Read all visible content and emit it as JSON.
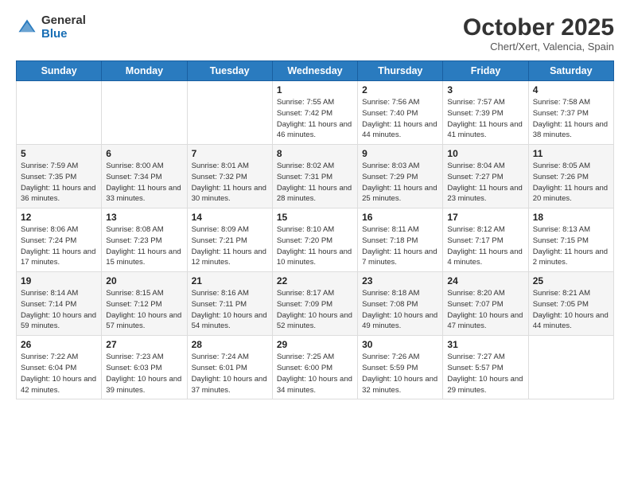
{
  "logo": {
    "general": "General",
    "blue": "Blue"
  },
  "title": "October 2025",
  "subtitle": "Chert/Xert, Valencia, Spain",
  "weekdays": [
    "Sunday",
    "Monday",
    "Tuesday",
    "Wednesday",
    "Thursday",
    "Friday",
    "Saturday"
  ],
  "weeks": [
    [
      {
        "day": "",
        "sunrise": "",
        "sunset": "",
        "daylight": ""
      },
      {
        "day": "",
        "sunrise": "",
        "sunset": "",
        "daylight": ""
      },
      {
        "day": "",
        "sunrise": "",
        "sunset": "",
        "daylight": ""
      },
      {
        "day": "1",
        "sunrise": "Sunrise: 7:55 AM",
        "sunset": "Sunset: 7:42 PM",
        "daylight": "Daylight: 11 hours and 46 minutes."
      },
      {
        "day": "2",
        "sunrise": "Sunrise: 7:56 AM",
        "sunset": "Sunset: 7:40 PM",
        "daylight": "Daylight: 11 hours and 44 minutes."
      },
      {
        "day": "3",
        "sunrise": "Sunrise: 7:57 AM",
        "sunset": "Sunset: 7:39 PM",
        "daylight": "Daylight: 11 hours and 41 minutes."
      },
      {
        "day": "4",
        "sunrise": "Sunrise: 7:58 AM",
        "sunset": "Sunset: 7:37 PM",
        "daylight": "Daylight: 11 hours and 38 minutes."
      }
    ],
    [
      {
        "day": "5",
        "sunrise": "Sunrise: 7:59 AM",
        "sunset": "Sunset: 7:35 PM",
        "daylight": "Daylight: 11 hours and 36 minutes."
      },
      {
        "day": "6",
        "sunrise": "Sunrise: 8:00 AM",
        "sunset": "Sunset: 7:34 PM",
        "daylight": "Daylight: 11 hours and 33 minutes."
      },
      {
        "day": "7",
        "sunrise": "Sunrise: 8:01 AM",
        "sunset": "Sunset: 7:32 PM",
        "daylight": "Daylight: 11 hours and 30 minutes."
      },
      {
        "day": "8",
        "sunrise": "Sunrise: 8:02 AM",
        "sunset": "Sunset: 7:31 PM",
        "daylight": "Daylight: 11 hours and 28 minutes."
      },
      {
        "day": "9",
        "sunrise": "Sunrise: 8:03 AM",
        "sunset": "Sunset: 7:29 PM",
        "daylight": "Daylight: 11 hours and 25 minutes."
      },
      {
        "day": "10",
        "sunrise": "Sunrise: 8:04 AM",
        "sunset": "Sunset: 7:27 PM",
        "daylight": "Daylight: 11 hours and 23 minutes."
      },
      {
        "day": "11",
        "sunrise": "Sunrise: 8:05 AM",
        "sunset": "Sunset: 7:26 PM",
        "daylight": "Daylight: 11 hours and 20 minutes."
      }
    ],
    [
      {
        "day": "12",
        "sunrise": "Sunrise: 8:06 AM",
        "sunset": "Sunset: 7:24 PM",
        "daylight": "Daylight: 11 hours and 17 minutes."
      },
      {
        "day": "13",
        "sunrise": "Sunrise: 8:08 AM",
        "sunset": "Sunset: 7:23 PM",
        "daylight": "Daylight: 11 hours and 15 minutes."
      },
      {
        "day": "14",
        "sunrise": "Sunrise: 8:09 AM",
        "sunset": "Sunset: 7:21 PM",
        "daylight": "Daylight: 11 hours and 12 minutes."
      },
      {
        "day": "15",
        "sunrise": "Sunrise: 8:10 AM",
        "sunset": "Sunset: 7:20 PM",
        "daylight": "Daylight: 11 hours and 10 minutes."
      },
      {
        "day": "16",
        "sunrise": "Sunrise: 8:11 AM",
        "sunset": "Sunset: 7:18 PM",
        "daylight": "Daylight: 11 hours and 7 minutes."
      },
      {
        "day": "17",
        "sunrise": "Sunrise: 8:12 AM",
        "sunset": "Sunset: 7:17 PM",
        "daylight": "Daylight: 11 hours and 4 minutes."
      },
      {
        "day": "18",
        "sunrise": "Sunrise: 8:13 AM",
        "sunset": "Sunset: 7:15 PM",
        "daylight": "Daylight: 11 hours and 2 minutes."
      }
    ],
    [
      {
        "day": "19",
        "sunrise": "Sunrise: 8:14 AM",
        "sunset": "Sunset: 7:14 PM",
        "daylight": "Daylight: 10 hours and 59 minutes."
      },
      {
        "day": "20",
        "sunrise": "Sunrise: 8:15 AM",
        "sunset": "Sunset: 7:12 PM",
        "daylight": "Daylight: 10 hours and 57 minutes."
      },
      {
        "day": "21",
        "sunrise": "Sunrise: 8:16 AM",
        "sunset": "Sunset: 7:11 PM",
        "daylight": "Daylight: 10 hours and 54 minutes."
      },
      {
        "day": "22",
        "sunrise": "Sunrise: 8:17 AM",
        "sunset": "Sunset: 7:09 PM",
        "daylight": "Daylight: 10 hours and 52 minutes."
      },
      {
        "day": "23",
        "sunrise": "Sunrise: 8:18 AM",
        "sunset": "Sunset: 7:08 PM",
        "daylight": "Daylight: 10 hours and 49 minutes."
      },
      {
        "day": "24",
        "sunrise": "Sunrise: 8:20 AM",
        "sunset": "Sunset: 7:07 PM",
        "daylight": "Daylight: 10 hours and 47 minutes."
      },
      {
        "day": "25",
        "sunrise": "Sunrise: 8:21 AM",
        "sunset": "Sunset: 7:05 PM",
        "daylight": "Daylight: 10 hours and 44 minutes."
      }
    ],
    [
      {
        "day": "26",
        "sunrise": "Sunrise: 7:22 AM",
        "sunset": "Sunset: 6:04 PM",
        "daylight": "Daylight: 10 hours and 42 minutes."
      },
      {
        "day": "27",
        "sunrise": "Sunrise: 7:23 AM",
        "sunset": "Sunset: 6:03 PM",
        "daylight": "Daylight: 10 hours and 39 minutes."
      },
      {
        "day": "28",
        "sunrise": "Sunrise: 7:24 AM",
        "sunset": "Sunset: 6:01 PM",
        "daylight": "Daylight: 10 hours and 37 minutes."
      },
      {
        "day": "29",
        "sunrise": "Sunrise: 7:25 AM",
        "sunset": "Sunset: 6:00 PM",
        "daylight": "Daylight: 10 hours and 34 minutes."
      },
      {
        "day": "30",
        "sunrise": "Sunrise: 7:26 AM",
        "sunset": "Sunset: 5:59 PM",
        "daylight": "Daylight: 10 hours and 32 minutes."
      },
      {
        "day": "31",
        "sunrise": "Sunrise: 7:27 AM",
        "sunset": "Sunset: 5:57 PM",
        "daylight": "Daylight: 10 hours and 29 minutes."
      },
      {
        "day": "",
        "sunrise": "",
        "sunset": "",
        "daylight": ""
      }
    ]
  ]
}
